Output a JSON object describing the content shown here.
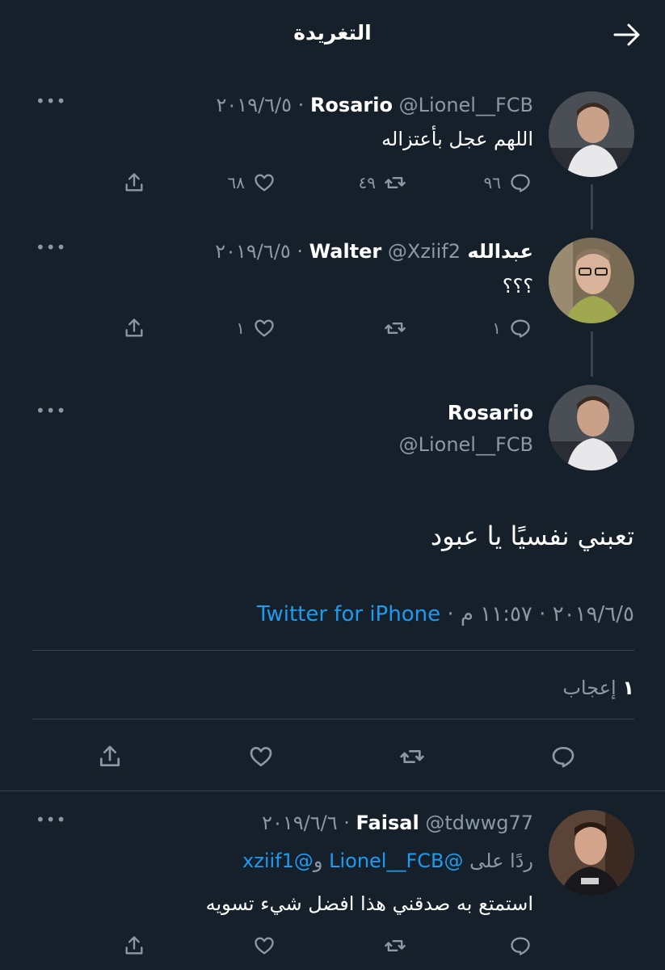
{
  "header": {
    "title": "التغريدة"
  },
  "tweets": [
    {
      "name": "Rosario",
      "handle": "@Lionel__FCB",
      "date": "٢٠١٩/٦/٥",
      "text": "اللهم عجل بأعتزاله",
      "replies": "٩٦",
      "retweets": "٤٩",
      "likes": "٦٨"
    },
    {
      "name": "عبدالله Walter",
      "handle": "@Xziif2",
      "date": "٢٠١٩/٦/٥",
      "text": "؟؟؟",
      "replies": "١",
      "retweets": "",
      "likes": "١"
    }
  ],
  "main_tweet": {
    "name": "Rosario",
    "handle": "@Lionel__FCB",
    "text": "تعبني نفسيًا يا عبود",
    "date": "٢٠١٩/٦/٥",
    "time": "١١:٥٧ م",
    "source": "Twitter for iPhone",
    "likes_count": "١",
    "likes_label": "إعجاب"
  },
  "reply": {
    "name": "Faisal",
    "handle": "@tdwwg77",
    "date": "٢٠١٩/٦/٦",
    "replying_prefix": "ردًا على",
    "replying_user1": "@Lionel__FCB",
    "replying_and": "و",
    "replying_user2": "@xziif1",
    "text": "استمتع به صدقني هذا افضل شيء تسويه"
  },
  "colors": {
    "background": "#15202b",
    "divider": "#38444d",
    "secondary_text": "#8b98a5",
    "link": "#1d9bf0"
  }
}
